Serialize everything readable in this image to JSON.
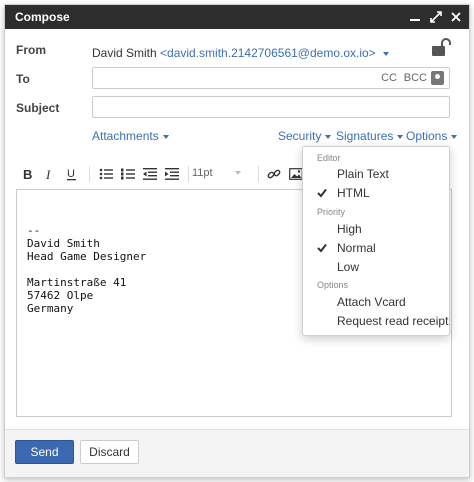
{
  "window": {
    "title": "Compose",
    "controls": [
      "minimize-icon",
      "fullscreen-icon",
      "close-icon"
    ]
  },
  "from": {
    "label": "From",
    "name": "David Smith",
    "email": "<david.smith.2142706561@demo.ox.io>"
  },
  "to": {
    "label": "To",
    "value": "",
    "cc_label": "CC",
    "bcc_label": "BCC"
  },
  "subject": {
    "label": "Subject",
    "value": ""
  },
  "links": {
    "attachments": "Attachments",
    "security": "Security",
    "signatures": "Signatures",
    "options": "Options"
  },
  "toolbar": {
    "font_size": "11pt",
    "buttons": [
      "bold-icon",
      "italic-icon",
      "underline-icon",
      "bullet-list-icon",
      "numbered-list-icon",
      "outdent-icon",
      "indent-icon",
      "link-icon",
      "image-icon"
    ]
  },
  "editor": {
    "signature_lines": [
      "--",
      "David Smith",
      "Head Game Designer",
      "",
      "Martinstraße 41",
      "57462 Olpe",
      "Germany"
    ]
  },
  "options_menu": {
    "editor_header": "Editor",
    "plain_text": "Plain Text",
    "html": "HTML",
    "priority_header": "Priority",
    "high": "High",
    "normal": "Normal",
    "low": "Low",
    "options_header": "Options",
    "attach_vcard": "Attach Vcard",
    "request_read_receipt": "Request read receipt",
    "selected_editor": "HTML",
    "selected_priority": "Normal"
  },
  "footer": {
    "send": "Send",
    "discard": "Discard"
  },
  "colors": {
    "titlebar": "#2d2d2d",
    "link": "#3c6fb4",
    "primary_button": "#3c68b0"
  }
}
